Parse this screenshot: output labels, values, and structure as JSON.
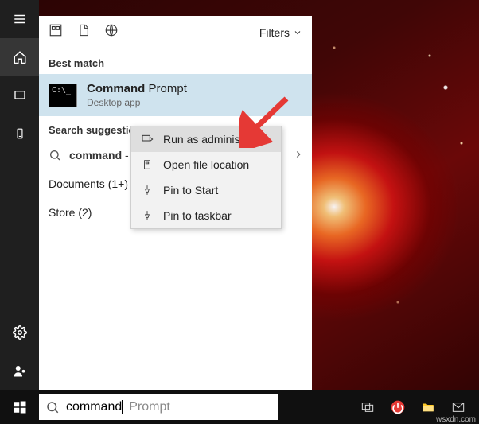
{
  "sidebar": {
    "items": [
      {
        "name": "menu-icon"
      },
      {
        "name": "home-icon"
      },
      {
        "name": "screen-icon"
      },
      {
        "name": "device-icon"
      },
      {
        "name": "settings-icon"
      },
      {
        "name": "user-icon"
      }
    ]
  },
  "panel": {
    "filters_label": "Filters",
    "best_match_label": "Best match",
    "best_match": {
      "title_bold": "Command",
      "title_rest": " Prompt",
      "subtitle": "Desktop app",
      "icon_text": "C:\\_"
    },
    "search_suggestions_label": "Search suggestions",
    "suggestion_prefix": "command",
    "suggestion_rest": " -",
    "documents_label": "Documents (1+)",
    "store_label": "Store (2)"
  },
  "context_menu": {
    "items": [
      {
        "label": "Run as administrator",
        "icon": "admin"
      },
      {
        "label": "Open file location",
        "icon": "folder"
      },
      {
        "label": "Pin to Start",
        "icon": "pin"
      },
      {
        "label": "Pin to taskbar",
        "icon": "pin"
      }
    ]
  },
  "taskbar": {
    "search_value": "command",
    "search_placeholder_rest": "Prompt"
  },
  "watermark": "wsxdn.com",
  "colors": {
    "highlight": "#cfe3ee",
    "arrow": "#e53935",
    "power": "#e53935",
    "folder": "#ffca28"
  }
}
